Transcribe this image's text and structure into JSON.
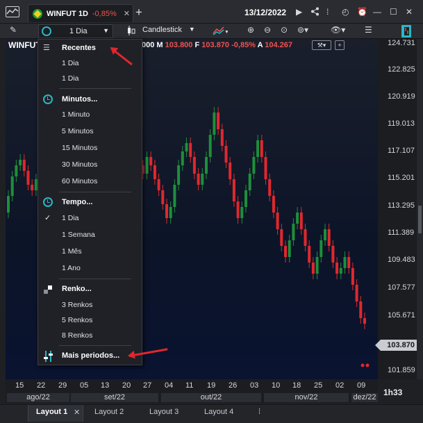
{
  "titlebar": {
    "tab_title": "WINFUT 1D",
    "tab_change": "-0,85%",
    "tab_close": "✕",
    "add_tab": "+",
    "date": "13/12/2022"
  },
  "toolbar": {
    "interval_value": "1 Dia",
    "chart_type": "Candlestick"
  },
  "quote": {
    "symbol": "WINFUT",
    "line_lead": "000",
    "m_label": "M",
    "m_value": "103.800",
    "f_label": "F",
    "f_value": "103.870",
    "change": "-0,85%",
    "a_label": "A",
    "a_value": "104.267",
    "last_price": "103.870"
  },
  "price_axis": [
    "124.731",
    "122.825",
    "120.919",
    "119.013",
    "117.107",
    "115.201",
    "113.295",
    "111.389",
    "109.483",
    "107.577",
    "105.671",
    "101.859"
  ],
  "time_axis": {
    "ticks": [
      "15",
      "22",
      "29",
      "05",
      "13",
      "20",
      "27",
      "04",
      "11",
      "19",
      "26",
      "03",
      "10",
      "18",
      "25",
      "02",
      "09"
    ],
    "months": [
      "ago/22",
      "set/22",
      "out/22",
      "nov/22",
      "dez/22"
    ],
    "zoom": "1h33"
  },
  "menu": {
    "recentes": "Recentes",
    "recent_items": [
      "1 Dia",
      "1 Dia"
    ],
    "minutos": "Minutos...",
    "minute_items": [
      "1 Minuto",
      "5 Minutos",
      "15 Minutos",
      "30 Minutos",
      "60 Minutos"
    ],
    "tempo": "Tempo...",
    "tempo_items": [
      "1 Dia",
      "1 Semana",
      "1 Mês",
      "1 Ano"
    ],
    "renko": "Renko...",
    "renko_items": [
      "3 Renkos",
      "5 Renkos",
      "8 Renkos"
    ],
    "mais": "Mais periodos..."
  },
  "bottom_tabs": {
    "layouts": [
      "Layout 1",
      "Layout 2",
      "Layout 3",
      "Layout 4"
    ],
    "close": "✕"
  },
  "colors": {
    "bull": "#1e8f3a",
    "bear": "#e0282e",
    "accent": "#2ab7c6",
    "annotation": "#e2262d"
  }
}
